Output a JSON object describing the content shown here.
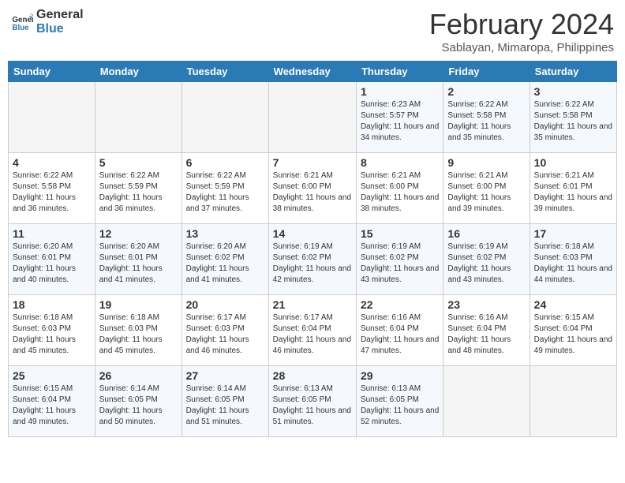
{
  "header": {
    "logo_line1": "General",
    "logo_line2": "Blue",
    "title": "February 2024",
    "subtitle": "Sablayan, Mimaropa, Philippines"
  },
  "weekdays": [
    "Sunday",
    "Monday",
    "Tuesday",
    "Wednesday",
    "Thursday",
    "Friday",
    "Saturday"
  ],
  "weeks": [
    [
      null,
      null,
      null,
      null,
      {
        "day": "1",
        "sunrise": "6:23 AM",
        "sunset": "5:57 PM",
        "daylight": "11 hours and 34 minutes."
      },
      {
        "day": "2",
        "sunrise": "6:22 AM",
        "sunset": "5:58 PM",
        "daylight": "11 hours and 35 minutes."
      },
      {
        "day": "3",
        "sunrise": "6:22 AM",
        "sunset": "5:58 PM",
        "daylight": "11 hours and 35 minutes."
      }
    ],
    [
      {
        "day": "4",
        "sunrise": "6:22 AM",
        "sunset": "5:58 PM",
        "daylight": "11 hours and 36 minutes."
      },
      {
        "day": "5",
        "sunrise": "6:22 AM",
        "sunset": "5:59 PM",
        "daylight": "11 hours and 36 minutes."
      },
      {
        "day": "6",
        "sunrise": "6:22 AM",
        "sunset": "5:59 PM",
        "daylight": "11 hours and 37 minutes."
      },
      {
        "day": "7",
        "sunrise": "6:21 AM",
        "sunset": "6:00 PM",
        "daylight": "11 hours and 38 minutes."
      },
      {
        "day": "8",
        "sunrise": "6:21 AM",
        "sunset": "6:00 PM",
        "daylight": "11 hours and 38 minutes."
      },
      {
        "day": "9",
        "sunrise": "6:21 AM",
        "sunset": "6:00 PM",
        "daylight": "11 hours and 39 minutes."
      },
      {
        "day": "10",
        "sunrise": "6:21 AM",
        "sunset": "6:01 PM",
        "daylight": "11 hours and 39 minutes."
      }
    ],
    [
      {
        "day": "11",
        "sunrise": "6:20 AM",
        "sunset": "6:01 PM",
        "daylight": "11 hours and 40 minutes."
      },
      {
        "day": "12",
        "sunrise": "6:20 AM",
        "sunset": "6:01 PM",
        "daylight": "11 hours and 41 minutes."
      },
      {
        "day": "13",
        "sunrise": "6:20 AM",
        "sunset": "6:02 PM",
        "daylight": "11 hours and 41 minutes."
      },
      {
        "day": "14",
        "sunrise": "6:19 AM",
        "sunset": "6:02 PM",
        "daylight": "11 hours and 42 minutes."
      },
      {
        "day": "15",
        "sunrise": "6:19 AM",
        "sunset": "6:02 PM",
        "daylight": "11 hours and 43 minutes."
      },
      {
        "day": "16",
        "sunrise": "6:19 AM",
        "sunset": "6:02 PM",
        "daylight": "11 hours and 43 minutes."
      },
      {
        "day": "17",
        "sunrise": "6:18 AM",
        "sunset": "6:03 PM",
        "daylight": "11 hours and 44 minutes."
      }
    ],
    [
      {
        "day": "18",
        "sunrise": "6:18 AM",
        "sunset": "6:03 PM",
        "daylight": "11 hours and 45 minutes."
      },
      {
        "day": "19",
        "sunrise": "6:18 AM",
        "sunset": "6:03 PM",
        "daylight": "11 hours and 45 minutes."
      },
      {
        "day": "20",
        "sunrise": "6:17 AM",
        "sunset": "6:03 PM",
        "daylight": "11 hours and 46 minutes."
      },
      {
        "day": "21",
        "sunrise": "6:17 AM",
        "sunset": "6:04 PM",
        "daylight": "11 hours and 46 minutes."
      },
      {
        "day": "22",
        "sunrise": "6:16 AM",
        "sunset": "6:04 PM",
        "daylight": "11 hours and 47 minutes."
      },
      {
        "day": "23",
        "sunrise": "6:16 AM",
        "sunset": "6:04 PM",
        "daylight": "11 hours and 48 minutes."
      },
      {
        "day": "24",
        "sunrise": "6:15 AM",
        "sunset": "6:04 PM",
        "daylight": "11 hours and 49 minutes."
      }
    ],
    [
      {
        "day": "25",
        "sunrise": "6:15 AM",
        "sunset": "6:04 PM",
        "daylight": "11 hours and 49 minutes."
      },
      {
        "day": "26",
        "sunrise": "6:14 AM",
        "sunset": "6:05 PM",
        "daylight": "11 hours and 50 minutes."
      },
      {
        "day": "27",
        "sunrise": "6:14 AM",
        "sunset": "6:05 PM",
        "daylight": "11 hours and 51 minutes."
      },
      {
        "day": "28",
        "sunrise": "6:13 AM",
        "sunset": "6:05 PM",
        "daylight": "11 hours and 51 minutes."
      },
      {
        "day": "29",
        "sunrise": "6:13 AM",
        "sunset": "6:05 PM",
        "daylight": "11 hours and 52 minutes."
      },
      null,
      null
    ]
  ],
  "colors": {
    "header_bg": "#2a7ab5",
    "logo_blue": "#2a7ab5"
  }
}
